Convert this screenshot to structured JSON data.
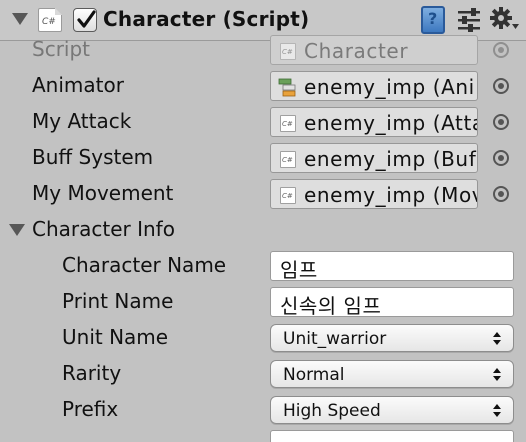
{
  "component": {
    "title": "Character (Script)",
    "enabled": true
  },
  "fields": {
    "script": {
      "label": "Script",
      "value": "Character"
    },
    "animator": {
      "label": "Animator",
      "value": "enemy_imp (Ani"
    },
    "my_attack": {
      "label": "My Attack",
      "value": "enemy_imp (Atta"
    },
    "buff_system": {
      "label": "Buff System",
      "value": "enemy_imp (Buf"
    },
    "my_movement": {
      "label": "My Movement",
      "value": "enemy_imp (Mov"
    }
  },
  "character_info": {
    "label": "Character Info",
    "character_name": {
      "label": "Character Name",
      "value": "임프"
    },
    "print_name": {
      "label": "Print Name",
      "value": "신속의 임프"
    },
    "unit_name": {
      "label": "Unit Name",
      "value": "Unit_warrior"
    },
    "rarity": {
      "label": "Rarity",
      "value": "Normal"
    },
    "prefix": {
      "label": "Prefix",
      "value": "High Speed"
    }
  },
  "icons": {
    "foldout": "triangle-down-icon",
    "script": "csharp-script-icon",
    "animator": "animator-controller-icon",
    "help": "help-book-icon",
    "presets": "preset-sliders-icon",
    "settings": "gear-icon",
    "object_picker": "object-picker-icon",
    "dropdown": "up-down-arrows-icon"
  },
  "colors": {
    "panel_bg": "#c2c2c2",
    "header_bg": "#c8c8c8",
    "text": "#111111",
    "disabled_text": "#777777",
    "help_blue": "#3d78c0"
  }
}
